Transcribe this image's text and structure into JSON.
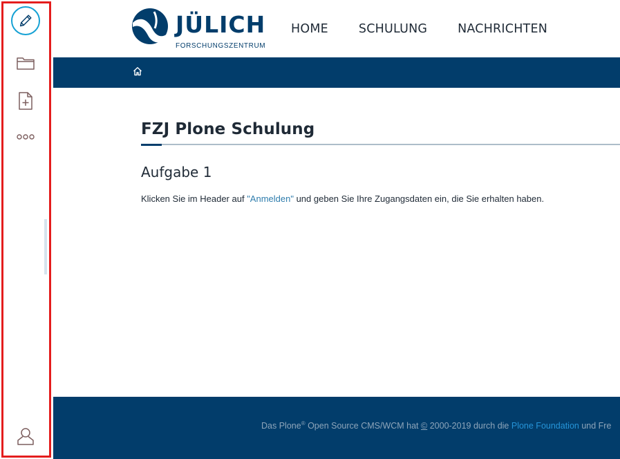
{
  "toolbar": {
    "items": [
      {
        "icon": "pencil-icon",
        "label": "Edit"
      },
      {
        "icon": "folder-icon",
        "label": "Contents"
      },
      {
        "icon": "add-file-icon",
        "label": "Add new"
      },
      {
        "icon": "more-icon",
        "label": "More"
      },
      {
        "icon": "user-icon",
        "label": "User"
      }
    ],
    "highlight_color": "#e41d1d",
    "accent_color": "#15a1d4"
  },
  "header": {
    "logo": {
      "name": "JÜLICH",
      "subtitle": "FORSCHUNGSZENTRUM"
    },
    "nav": [
      "HOME",
      "SCHULUNG",
      "NACHRICHTEN"
    ]
  },
  "breadcrumb": {
    "home_icon": "home-icon",
    "bar_color": "#023d6b"
  },
  "main": {
    "title": "FZJ Plone Schulung",
    "heading": "Aufgabe 1",
    "paragraph_before": "Klicken Sie im Header auf ",
    "link_text": "\"Anmelden\"",
    "paragraph_after": " und geben Sie Ihre Zugangsdaten ein, die Sie erhalten haben."
  },
  "footer": {
    "text_part1": "Das Plone",
    "registered": "®",
    "text_part2": " Open Source CMS/WCM hat ",
    "copyright": "©",
    "text_part3": " 2000-2019 durch die ",
    "link": "Plone Foundation",
    "text_part4": " und Fre",
    "bg_color": "#023d6b"
  }
}
